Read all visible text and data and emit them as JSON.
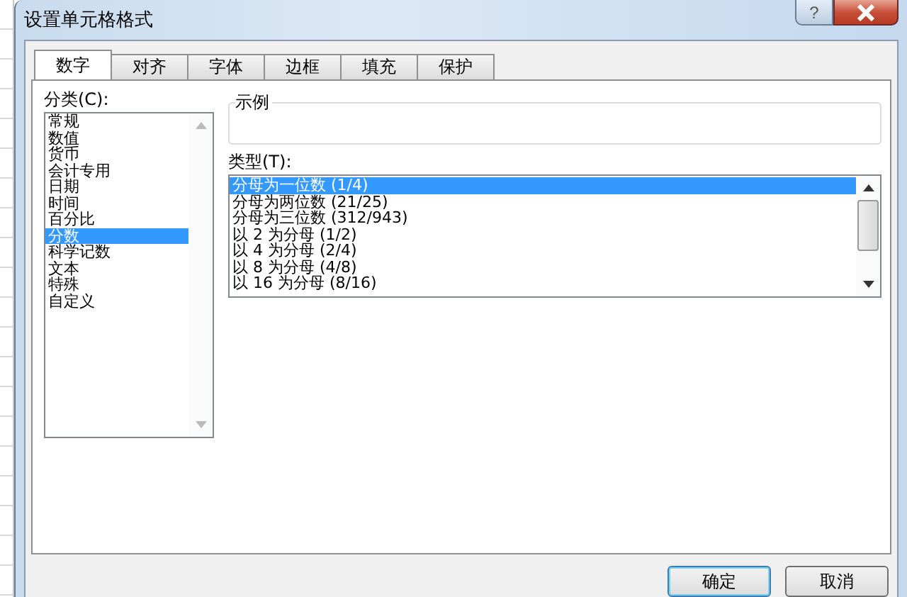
{
  "window": {
    "title": "设置单元格格式",
    "help": "?"
  },
  "tabs": [
    {
      "label": "数字",
      "selected": true
    },
    {
      "label": "对齐",
      "selected": false
    },
    {
      "label": "字体",
      "selected": false
    },
    {
      "label": "边框",
      "selected": false
    },
    {
      "label": "填充",
      "selected": false
    },
    {
      "label": "保护",
      "selected": false
    }
  ],
  "category": {
    "label": "分类(C):",
    "items": [
      {
        "label": "常规",
        "selected": false
      },
      {
        "label": "数值",
        "selected": false
      },
      {
        "label": "货币",
        "selected": false
      },
      {
        "label": "会计专用",
        "selected": false
      },
      {
        "label": "日期",
        "selected": false
      },
      {
        "label": "时间",
        "selected": false
      },
      {
        "label": "百分比",
        "selected": false
      },
      {
        "label": "分数",
        "selected": true
      },
      {
        "label": "科学记数",
        "selected": false
      },
      {
        "label": "文本",
        "selected": false
      },
      {
        "label": "特殊",
        "selected": false
      },
      {
        "label": "自定义",
        "selected": false
      }
    ]
  },
  "sample": {
    "label": "示例"
  },
  "type": {
    "label": "类型(T):",
    "items": [
      {
        "label": "分母为一位数 (1/4)",
        "selected": true
      },
      {
        "label": "分母为两位数 (21/25)",
        "selected": false
      },
      {
        "label": "分母为三位数 (312/943)",
        "selected": false
      },
      {
        "label": "以 2 为分母 (1/2)",
        "selected": false
      },
      {
        "label": "以 4 为分母 (2/4)",
        "selected": false
      },
      {
        "label": "以 8 为分母 (4/8)",
        "selected": false
      },
      {
        "label": "以 16 为分母 (8/16)",
        "selected": false
      }
    ]
  },
  "buttons": [
    "确定",
    "取消"
  ]
}
